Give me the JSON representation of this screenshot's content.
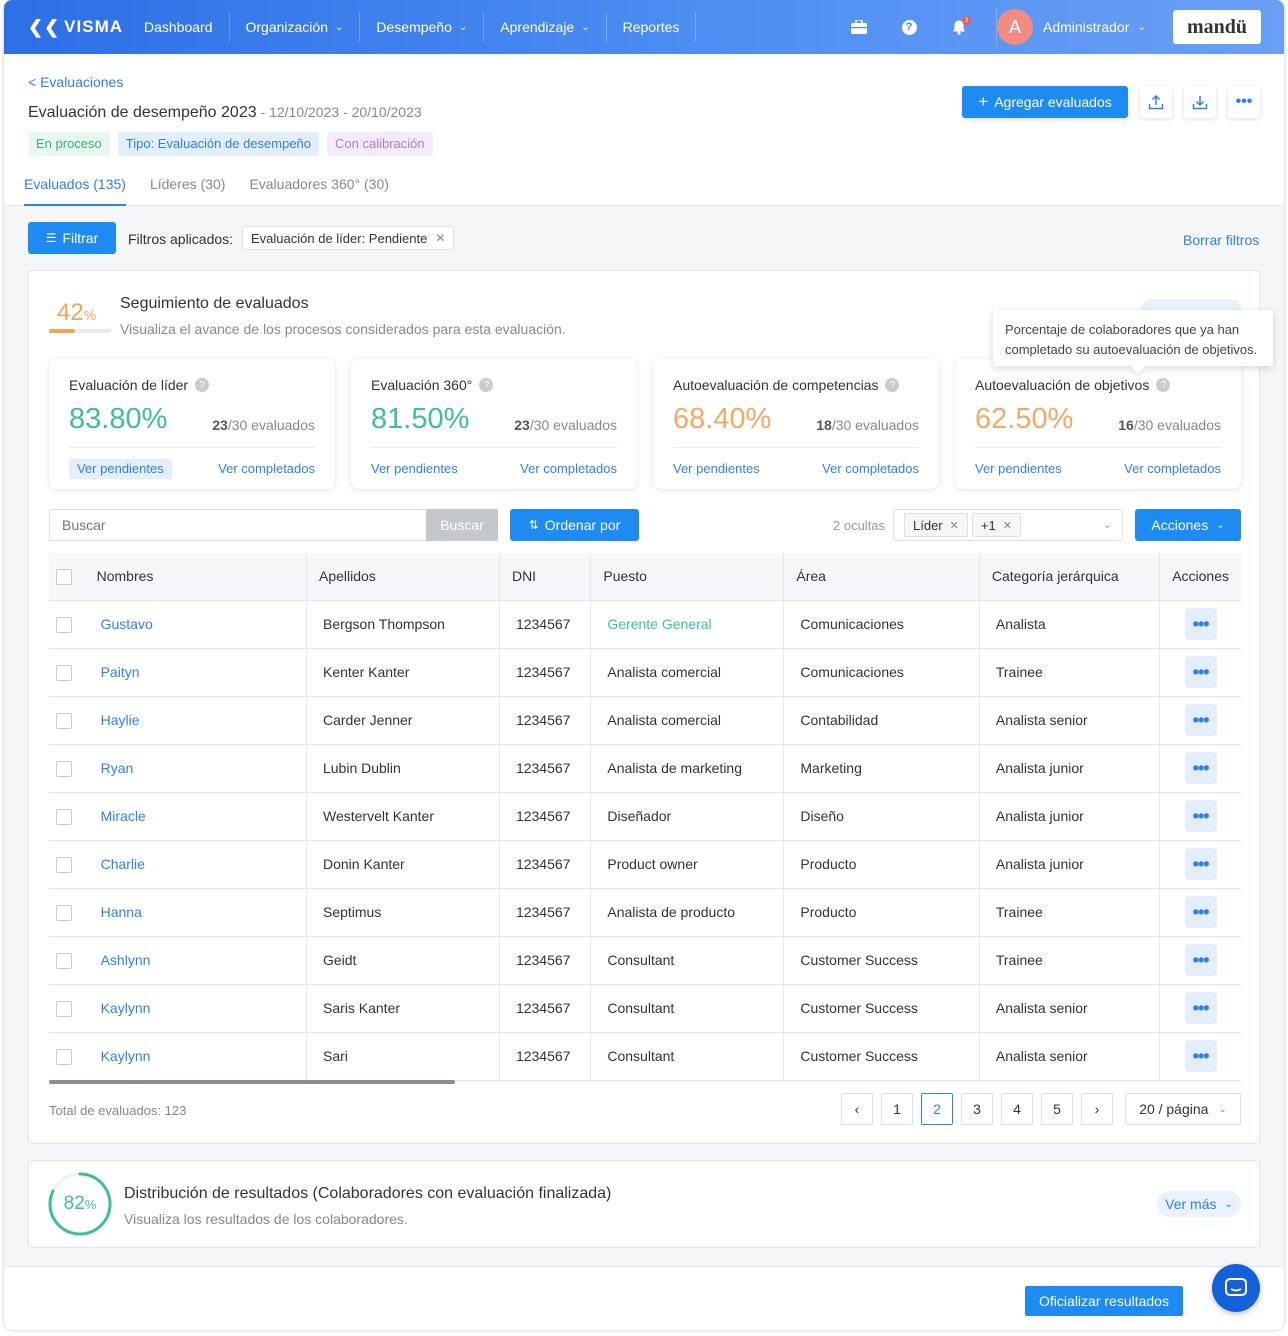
{
  "nav": {
    "logo": "VISMA",
    "items": [
      {
        "label": "Dashboard",
        "dropdown": false
      },
      {
        "label": "Organización",
        "dropdown": true
      },
      {
        "label": "Desempeño",
        "dropdown": true
      },
      {
        "label": "Aprendizaje",
        "dropdown": true
      },
      {
        "label": "Reportes",
        "dropdown": false
      }
    ],
    "notification_count": "3",
    "avatar_initial": "A",
    "user_name": "Administrador",
    "brand": "mandü"
  },
  "header": {
    "back_label": "< Evaluaciones",
    "title": "Evaluación de desempeño 2023",
    "dates": " - 12/10/2023 - 20/10/2023",
    "tags": [
      "En proceso",
      "Tipo: Evaluación de desempeño",
      "Con calibración"
    ],
    "tabs": [
      "Evaluados (135)",
      "Líderes (30)",
      "Evaluadores 360° (30)"
    ],
    "add_button": "Agregar evaluados"
  },
  "filters": {
    "button": "Filtrar",
    "applied_label": "Filtros aplicados:",
    "chip": "Evaluación de líder: Pendiente",
    "clear": "Borrar filtros"
  },
  "tracking": {
    "percent": "42",
    "percent_sign": "%",
    "progress": 0.42,
    "title": "Seguimiento de evaluados",
    "subtitle": "Visualiza el avance de los procesos considerados para esta evaluación.",
    "tooltip": "Porcentaje de colaboradores que ya han completado su autoevaluación de objetivos.",
    "cards": [
      {
        "title": "Evaluación de líder",
        "value": "83.80%",
        "done": "23",
        "total": "/30 evaluados",
        "pending": "Ver pendientes",
        "completed": "Ver completados",
        "color": "green"
      },
      {
        "title": "Evaluación 360°",
        "value": "81.50%",
        "done": "23",
        "total": "/30 evaluados",
        "pending": "Ver pendientes",
        "completed": "Ver completados",
        "color": "green"
      },
      {
        "title": "Autoevaluación de competencias",
        "value": "68.40%",
        "done": "18",
        "total": "/30 evaluados",
        "pending": "Ver pendientes",
        "completed": "Ver completados",
        "color": "orange"
      },
      {
        "title": "Autoevaluación de objetivos",
        "value": "62.50%",
        "done": "16",
        "total": "/30 evaluados",
        "pending": "Ver pendientes",
        "completed": "Ver completados",
        "color": "orange"
      }
    ]
  },
  "toolbar": {
    "search_placeholder": "Buscar",
    "search_button": "Buscar",
    "sort_button": "Ordenar por",
    "hidden_count": "2 ocultas",
    "column_chips": [
      "Líder",
      "+1"
    ],
    "actions_button": "Acciones"
  },
  "table": {
    "columns": [
      "Nombres",
      "Apellidos",
      "DNI",
      "Puesto",
      "Área",
      "Categoría jerárquica",
      "Acciones"
    ],
    "rows": [
      {
        "nombre": "Gustavo",
        "apellido": "Bergson Thompson",
        "dni": "1234567",
        "puesto": "Gerente General",
        "area": "Comunicaciones",
        "categoria": "Analista"
      },
      {
        "nombre": "Paityn",
        "apellido": "Kenter Kanter",
        "dni": "1234567",
        "puesto": "Analista comercial",
        "area": "Comunicaciones",
        "categoria": "Trainee"
      },
      {
        "nombre": "Haylie",
        "apellido": "Carder Jenner",
        "dni": "1234567",
        "puesto": "Analista comercial",
        "area": "Contabilidad",
        "categoria": "Analista senior"
      },
      {
        "nombre": "Ryan",
        "apellido": "Lubin Dublin",
        "dni": "1234567",
        "puesto": "Analista de marketing",
        "area": "Marketing",
        "categoria": "Analista junior"
      },
      {
        "nombre": "Miracle",
        "apellido": "Westervelt Kanter",
        "dni": "1234567",
        "puesto": "Diseñador",
        "area": "Diseño",
        "categoria": "Analista junior"
      },
      {
        "nombre": "Charlie",
        "apellido": "Donin Kanter",
        "dni": "1234567",
        "puesto": "Product owner",
        "area": "Producto",
        "categoria": "Analista junior"
      },
      {
        "nombre": "Hanna",
        "apellido": "Septimus",
        "dni": "1234567",
        "puesto": "Analista de producto",
        "area": "Producto",
        "categoria": "Trainee"
      },
      {
        "nombre": "Ashlynn",
        "apellido": "Geidt",
        "dni": "1234567",
        "puesto": "Consultant",
        "area": "Customer Success",
        "categoria": "Trainee"
      },
      {
        "nombre": "Kaylynn",
        "apellido": "Saris Kanter",
        "dni": "1234567",
        "puesto": "Consultant",
        "area": "Customer Success",
        "categoria": "Analista senior"
      },
      {
        "nombre": "Kaylynn",
        "apellido": "Sari",
        "dni": "1234567",
        "puesto": "Consultant",
        "area": "Customer Success",
        "categoria": "Analista senior"
      }
    ],
    "total_label": "Total de evaluados: ",
    "total_value": "123",
    "pages": [
      "1",
      "2",
      "3",
      "4",
      "5"
    ],
    "current_page": "2",
    "per_page": "20 / página"
  },
  "distribution": {
    "percent": "82",
    "percent_sign": "%",
    "progress": 0.82,
    "title": "Distribución de resultados",
    "title_suffix": " (Colaboradores con evaluación finalizada)",
    "subtitle": "Visualiza los resultados de los colaboradores.",
    "more": "Ver más"
  },
  "footer": {
    "officialize": "Oficializar resultados"
  },
  "colors": {
    "primary": "#1d8bf1",
    "green": "#3cbf93",
    "orange": "#f3a865"
  }
}
